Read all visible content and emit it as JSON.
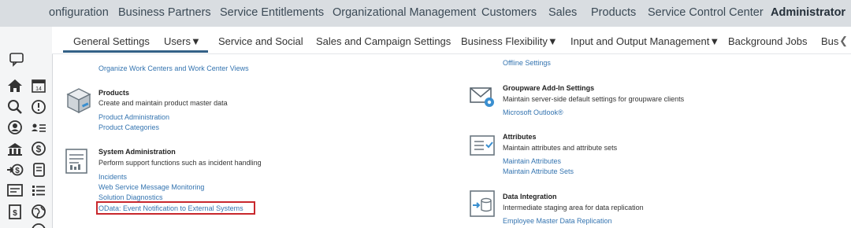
{
  "top_nav": {
    "items": [
      "onfiguration",
      "Business Partners",
      "Service Entitlements",
      "Organizational Management",
      "Customers",
      "Sales",
      "Products",
      "Service Control Center",
      "Administrator"
    ],
    "active_index": 8
  },
  "sub_nav": {
    "tabs": [
      "General Settings",
      "Users▼",
      "Service and Social",
      "Sales and Campaign Settings",
      "Business Flexibility▼",
      "Input and Output Management▼",
      "Background Jobs",
      "Bus"
    ],
    "active_index": 0,
    "scroll_icon": "chevron-left-icon"
  },
  "left_column": {
    "top_link": "Organize Work Centers and Work Center Views",
    "products": {
      "title": "Products",
      "description": "Create and maintain product master data",
      "links": [
        "Product Administration",
        "Product Categories"
      ],
      "icon": "box-icon"
    },
    "system_admin": {
      "title": "System Administration",
      "description": "Perform support functions such as incident handling",
      "links": [
        "Incidents",
        "Web Service Message Monitoring",
        "Solution Diagnostics",
        "OData: Event Notification to External Systems"
      ],
      "highlighted_link_index": 3,
      "icon": "document-settings-icon"
    }
  },
  "right_column": {
    "top_link": "Offline Settings",
    "groupware": {
      "title": "Groupware Add-In Settings",
      "description": "Maintain server-side default settings for groupware clients",
      "links": [
        "Microsoft Outlook®"
      ],
      "icon": "envelope-gear-icon"
    },
    "attributes": {
      "title": "Attributes",
      "description": "Maintain attributes and attribute sets",
      "links": [
        "Maintain Attributes",
        "Maintain Attribute Sets"
      ],
      "icon": "attribute-list-icon"
    },
    "data_integration": {
      "title": "Data Integration",
      "description": "Intermediate staging area for data replication",
      "links": [
        "Employee Master Data Replication"
      ],
      "icon": "database-import-icon"
    }
  },
  "rail_icons": [
    "feedback-icon",
    "home-icon",
    "calendar-icon",
    "search-icon",
    "alert-icon",
    "person-icon",
    "people-list-icon",
    "building-icon",
    "dollar-circle-icon",
    "money-transfer-icon",
    "document-stack-icon",
    "id-card-icon",
    "list-icon",
    "invoice-icon",
    "globe-icon"
  ],
  "colors": {
    "link": "#3474b0",
    "highlight": "#c8282d",
    "topnav_bg": "#d9dde1",
    "active_underline": "#346187"
  }
}
